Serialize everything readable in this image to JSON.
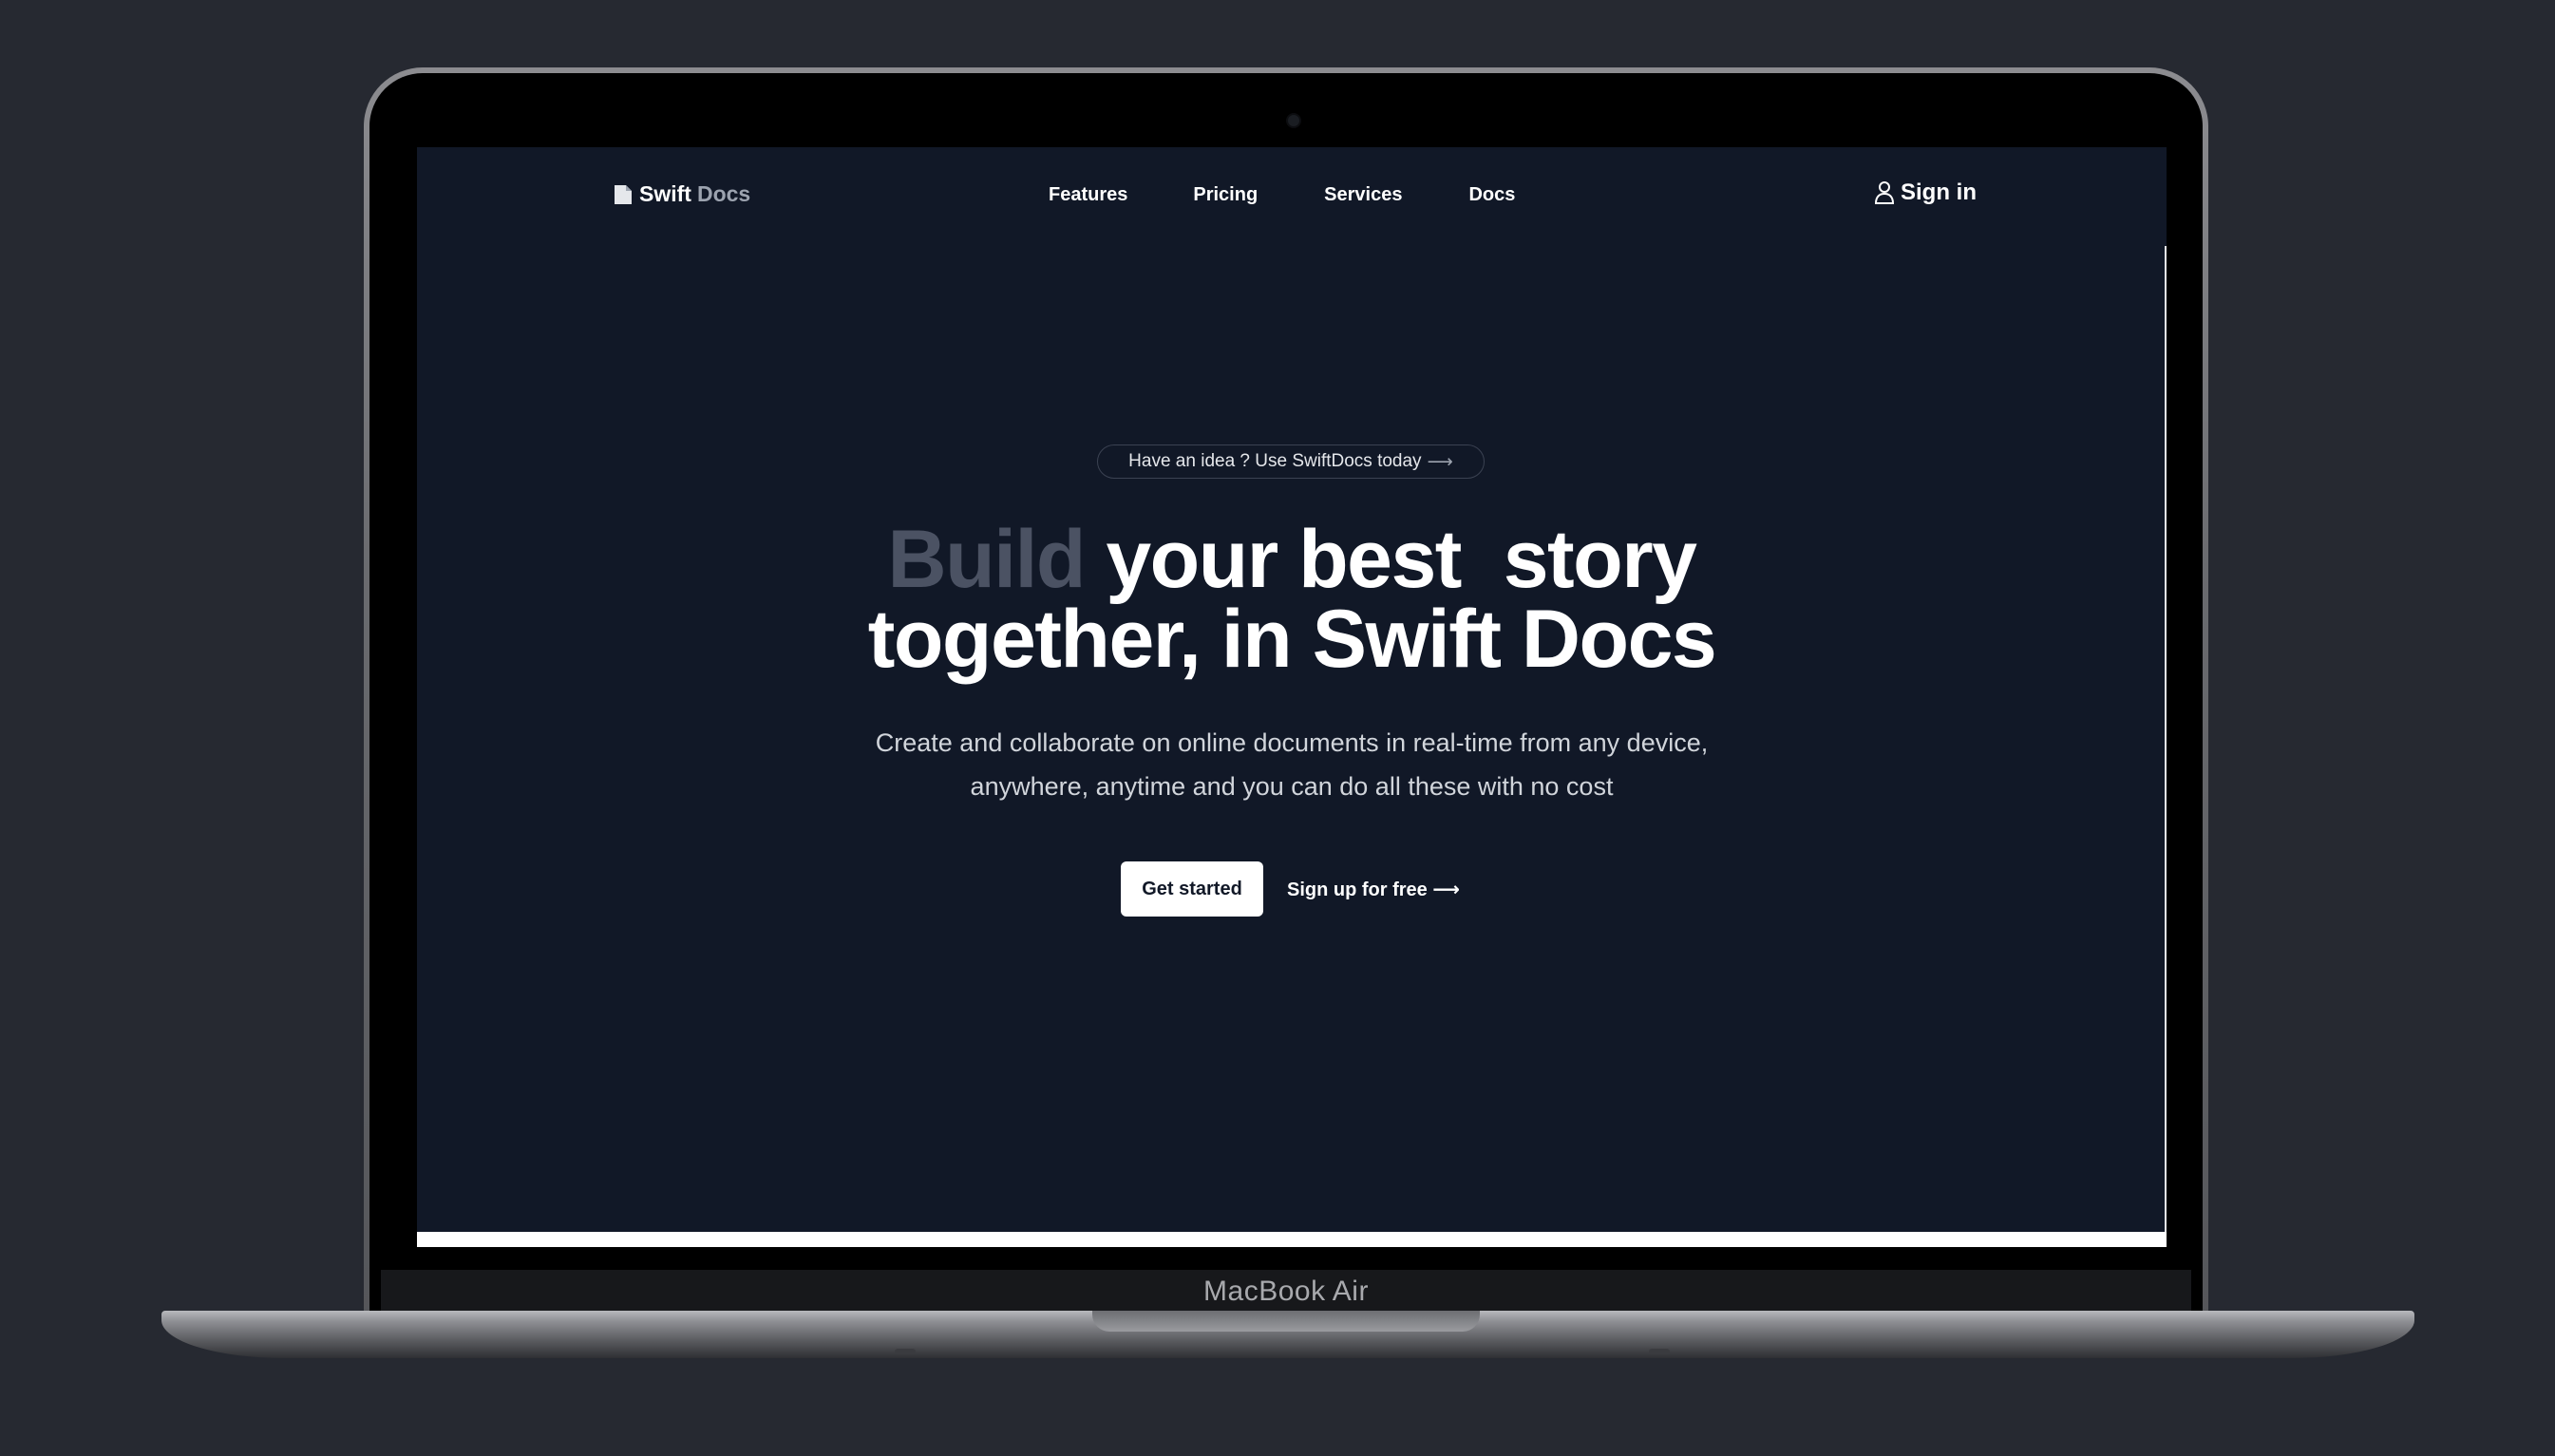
{
  "nav": {
    "logo_primary": "Swift",
    "logo_secondary": "Docs",
    "links": [
      "Features",
      "Pricing",
      "Services",
      "Docs"
    ],
    "signin_label": "Sign in"
  },
  "hero": {
    "badge_text": "Have an idea ? Use SwiftDocs today",
    "badge_arrow": "⟶",
    "headline_muted": "Build",
    "headline_line1_rest": "your best  story",
    "headline_line2": "together, in Swift Docs",
    "subtitle_line1": "Create and collaborate on online documents in real-time from any device,",
    "subtitle_line2": "anywhere, anytime and you can do all these with no cost",
    "cta_primary": "Get started",
    "cta_secondary": "Sign up for free ⟶"
  },
  "device": {
    "model_label": "MacBook Air"
  },
  "colors": {
    "page_background": "#262931",
    "screen_background": "#111827",
    "headline_muted": "#4b5263",
    "text_primary": "#ffffff",
    "logo_secondary": "#9ca3af"
  },
  "icons": {
    "logo": "document-icon",
    "signin": "user-icon",
    "arrow": "arrow-right-icon"
  }
}
